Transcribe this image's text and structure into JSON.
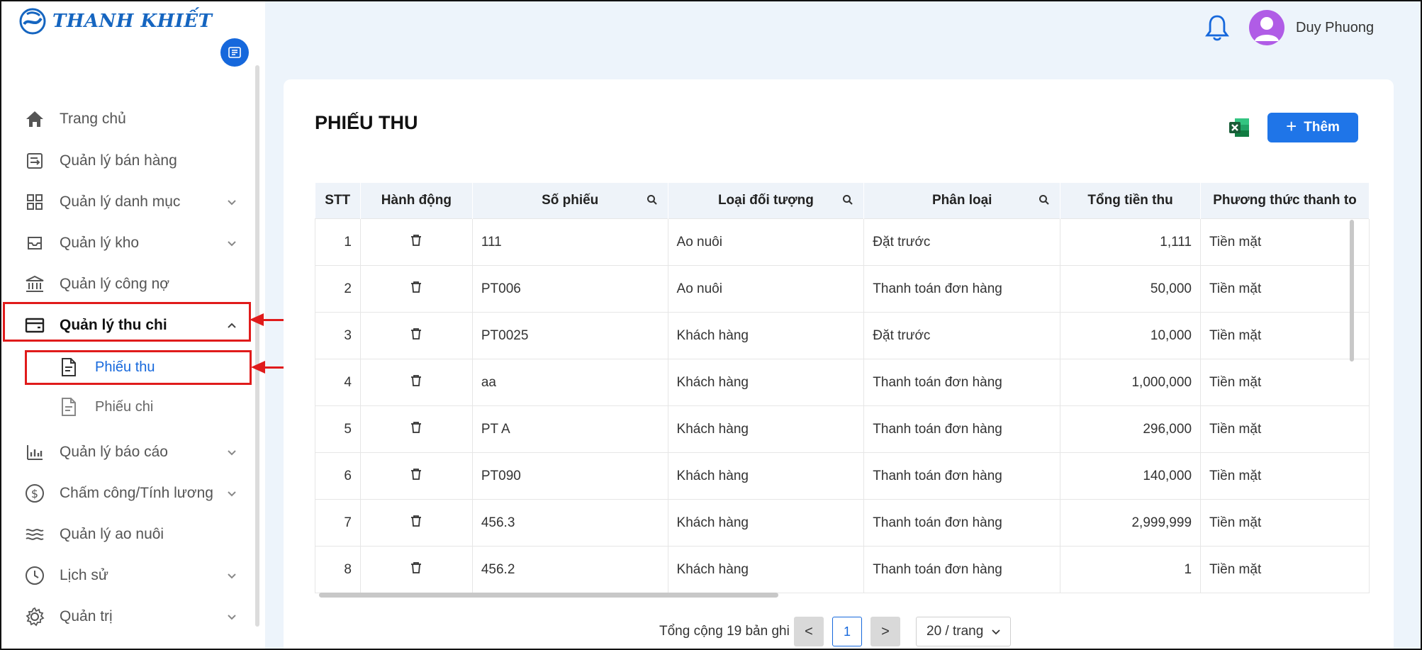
{
  "brand": {
    "name": "THANH KHIẾT"
  },
  "user": {
    "name": "Duy Phuong"
  },
  "sidebar": {
    "items": [
      {
        "label": "Trang chủ",
        "icon": "home-icon",
        "has_children": false
      },
      {
        "label": "Quản lý bán hàng",
        "icon": "sales-icon",
        "has_children": false
      },
      {
        "label": "Quản lý danh mục",
        "icon": "grid-icon",
        "has_children": true
      },
      {
        "label": "Quản lý kho",
        "icon": "inbox-icon",
        "has_children": true
      },
      {
        "label": "Quản lý công nợ",
        "icon": "bank-icon",
        "has_children": false
      },
      {
        "label": "Quản lý thu chi",
        "icon": "wallet-icon",
        "has_children": true,
        "expanded": true
      },
      {
        "label": "Quản lý báo cáo",
        "icon": "bar-chart-icon",
        "has_children": true
      },
      {
        "label": "Chấm công/Tính lương",
        "icon": "dollar-icon",
        "has_children": true
      },
      {
        "label": "Quản lý ao nuôi",
        "icon": "waves-icon",
        "has_children": false
      },
      {
        "label": "Lịch sử",
        "icon": "clock-icon",
        "has_children": true
      },
      {
        "label": "Quản trị",
        "icon": "gear-icon",
        "has_children": true
      }
    ],
    "sub_items": [
      {
        "label": "Phiếu thu",
        "icon": "document-icon",
        "selected": true
      },
      {
        "label": "Phiếu chi",
        "icon": "document-icon",
        "selected": false
      }
    ]
  },
  "page": {
    "title": "PHIẾU THU",
    "add_label": "Thêm"
  },
  "table": {
    "columns": [
      "STT",
      "Hành động",
      "Số phiếu",
      "Loại đối tượng",
      "Phân loại",
      "Tổng tiền thu",
      "Phương thức thanh to"
    ],
    "rows": [
      {
        "stt": "1",
        "so_phieu": "111",
        "loai": "Ao nuôi",
        "phan_loai": "Đặt trước",
        "tong": "1,111",
        "pt": "Tiền mặt"
      },
      {
        "stt": "2",
        "so_phieu": "PT006",
        "loai": "Ao nuôi",
        "phan_loai": "Thanh toán đơn hàng",
        "tong": "50,000",
        "pt": "Tiền mặt"
      },
      {
        "stt": "3",
        "so_phieu": "PT0025",
        "loai": "Khách hàng",
        "phan_loai": "Đặt trước",
        "tong": "10,000",
        "pt": "Tiền mặt"
      },
      {
        "stt": "4",
        "so_phieu": "aa",
        "loai": "Khách hàng",
        "phan_loai": "Thanh toán đơn hàng",
        "tong": "1,000,000",
        "pt": "Tiền mặt"
      },
      {
        "stt": "5",
        "so_phieu": "PT A",
        "loai": "Khách hàng",
        "phan_loai": "Thanh toán đơn hàng",
        "tong": "296,000",
        "pt": "Tiền mặt"
      },
      {
        "stt": "6",
        "so_phieu": "PT090",
        "loai": "Khách hàng",
        "phan_loai": "Thanh toán đơn hàng",
        "tong": "140,000",
        "pt": "Tiền mặt"
      },
      {
        "stt": "7",
        "so_phieu": "456.3",
        "loai": "Khách hàng",
        "phan_loai": "Thanh toán đơn hàng",
        "tong": "2,999,999",
        "pt": "Tiền mặt"
      },
      {
        "stt": "8",
        "so_phieu": "456.2",
        "loai": "Khách hàng",
        "phan_loai": "Thanh toán đơn hàng",
        "tong": "1",
        "pt": "Tiền mặt"
      }
    ]
  },
  "pagination": {
    "total_text": "Tổng cộng 19 bản ghi",
    "prev": "<",
    "current": "1",
    "next": ">",
    "page_size": "20 / trang"
  },
  "colors": {
    "accent": "#1668dc",
    "highlight": "#e01b1b",
    "header_bg": "#edf4fb"
  }
}
